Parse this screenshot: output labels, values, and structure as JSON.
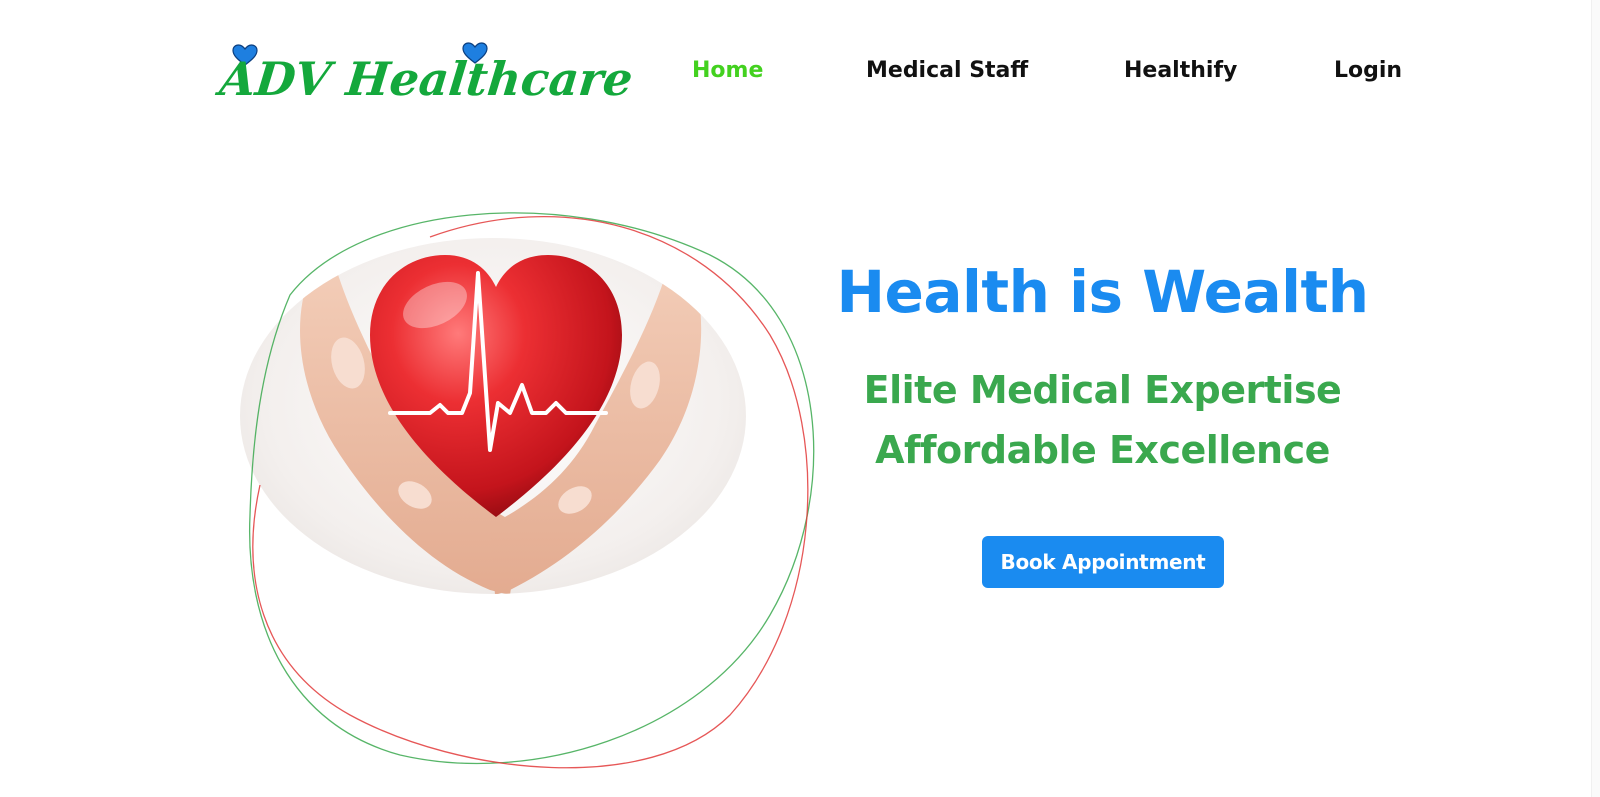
{
  "header": {
    "logo_text": "ADV Healthcare",
    "logo_heart_color": "#1e7fe0",
    "logo_text_color": "#14a83c"
  },
  "nav": {
    "items": [
      {
        "label": "Home",
        "active": true
      },
      {
        "label": "Medical Staff",
        "active": false
      },
      {
        "label": "Healthify",
        "active": false
      },
      {
        "label": "Login",
        "active": false
      }
    ],
    "active_color": "#43d11f",
    "default_color": "#111111"
  },
  "hero": {
    "title": "Health is Wealth",
    "subtitle_line1": "Elite Medical Expertise",
    "subtitle_line2": "Affordable Excellence",
    "cta_label": "Book Appointment",
    "title_color": "#1a8bf0",
    "subtitle_color": "#3aa84e",
    "image_icon": "heart-in-hands-icon",
    "ring_colors": [
      "#3aa84e",
      "#e23a3a"
    ]
  }
}
